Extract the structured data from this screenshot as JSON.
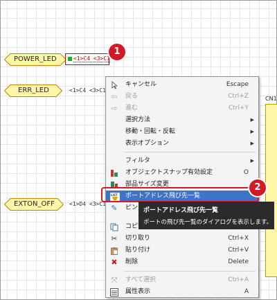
{
  "ports": [
    {
      "name": "POWER_LED",
      "pins": "<1>C4 <3>C1"
    },
    {
      "name": "ERR_LED",
      "pins": "<1>C4 <3>C1"
    },
    {
      "name": "EXTON_OFF",
      "pins": "<1>D4 <3>C1"
    }
  ],
  "component": {
    "ref": "CN1"
  },
  "badges": [
    "1",
    "2"
  ],
  "menu": {
    "items": [
      {
        "label": "キャンセル",
        "shortcut": "Escape",
        "icon": "pointer-icon"
      },
      {
        "label": "戻る",
        "shortcut": "Ctrl+Z",
        "icon": "undo-arrow-icon"
      },
      {
        "label": "進む",
        "shortcut": "Ctrl+Y",
        "icon": "redo-arrow-icon"
      },
      {
        "label": "選択方法",
        "shortcut": "",
        "icon": ""
      },
      {
        "label": "移動・回転・反転",
        "shortcut": "",
        "icon": ""
      },
      {
        "label": "表示オプション",
        "shortcut": "",
        "icon": ""
      },
      {
        "label": "フィルタ",
        "shortcut": "",
        "icon": ""
      },
      {
        "label": "オブジェクトスナップ有効設定",
        "shortcut": "O",
        "icon": "object-snap-icon"
      },
      {
        "label": "部品サイズ変更",
        "shortcut": "",
        "icon": "part-resize-icon"
      },
      {
        "label": "ポートアドレス飛び先一覧",
        "shortcut": "",
        "icon": "list-icon"
      },
      {
        "label": "ピン",
        "shortcut": "",
        "icon": "pin-icon"
      },
      {
        "label": "コピー",
        "shortcut": "",
        "icon": "copy-icon"
      },
      {
        "label": "切り取り",
        "shortcut": "Ctrl+X",
        "icon": "scissors-icon"
      },
      {
        "label": "貼り付け",
        "shortcut": "Ctrl+V",
        "icon": "paste-icon"
      },
      {
        "label": "削除",
        "shortcut": "Delete",
        "icon": "delete-x-icon"
      },
      {
        "label": "すべて選択",
        "shortcut": "Ctrl+A",
        "icon": "select-all-icon"
      },
      {
        "label": "属性表示",
        "shortcut": "A",
        "icon": "properties-icon"
      }
    ],
    "list_icon_text": "LIST"
  },
  "tooltip": {
    "title": "ポートアドレス飛び先一覧",
    "description": "ポートの飛び先一覧のダイアログを表示します。"
  },
  "colors": {
    "highlight": "#3c74c7",
    "annotation_red": "#d11a26",
    "port_fill": "#fff7a8"
  }
}
